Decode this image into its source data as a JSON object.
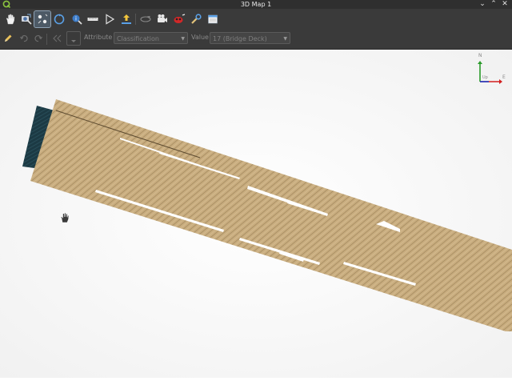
{
  "window": {
    "title": "3D Map 1",
    "app_icon": "qgis-logo-icon",
    "controls": [
      "chevron-down-icon",
      "maximize-icon",
      "close-icon"
    ]
  },
  "toolbar": {
    "tools": [
      "pan-hand-icon",
      "identify-camera-icon",
      "measure-points-icon",
      "rotate-camera-icon",
      "identify-icon",
      "measure-line-icon",
      "animation-play-icon",
      "export-upload-icon",
      "effects-icon",
      "camera-icon",
      "map-themes-icon",
      "options-wrench-icon",
      "layout-icon"
    ]
  },
  "edit_toolbar": {
    "tools": [
      "edit-pencil-icon",
      "undo-icon",
      "redo-icon",
      "select-previous-icon",
      "select-tool-icon"
    ],
    "attribute_label": "Attribute",
    "attribute_value": "Classification",
    "value_label": "Value",
    "value_value": "17 (Bridge Deck)"
  },
  "navigation": {
    "north": "N",
    "east": "E",
    "up": "Up"
  },
  "colors": {
    "titlebar": "#2f2f2f",
    "toolbar": "#3a3a3a",
    "deck": "#c9ad7f",
    "deck_dark": "#a48a60",
    "pillar": "#1c3a44"
  }
}
